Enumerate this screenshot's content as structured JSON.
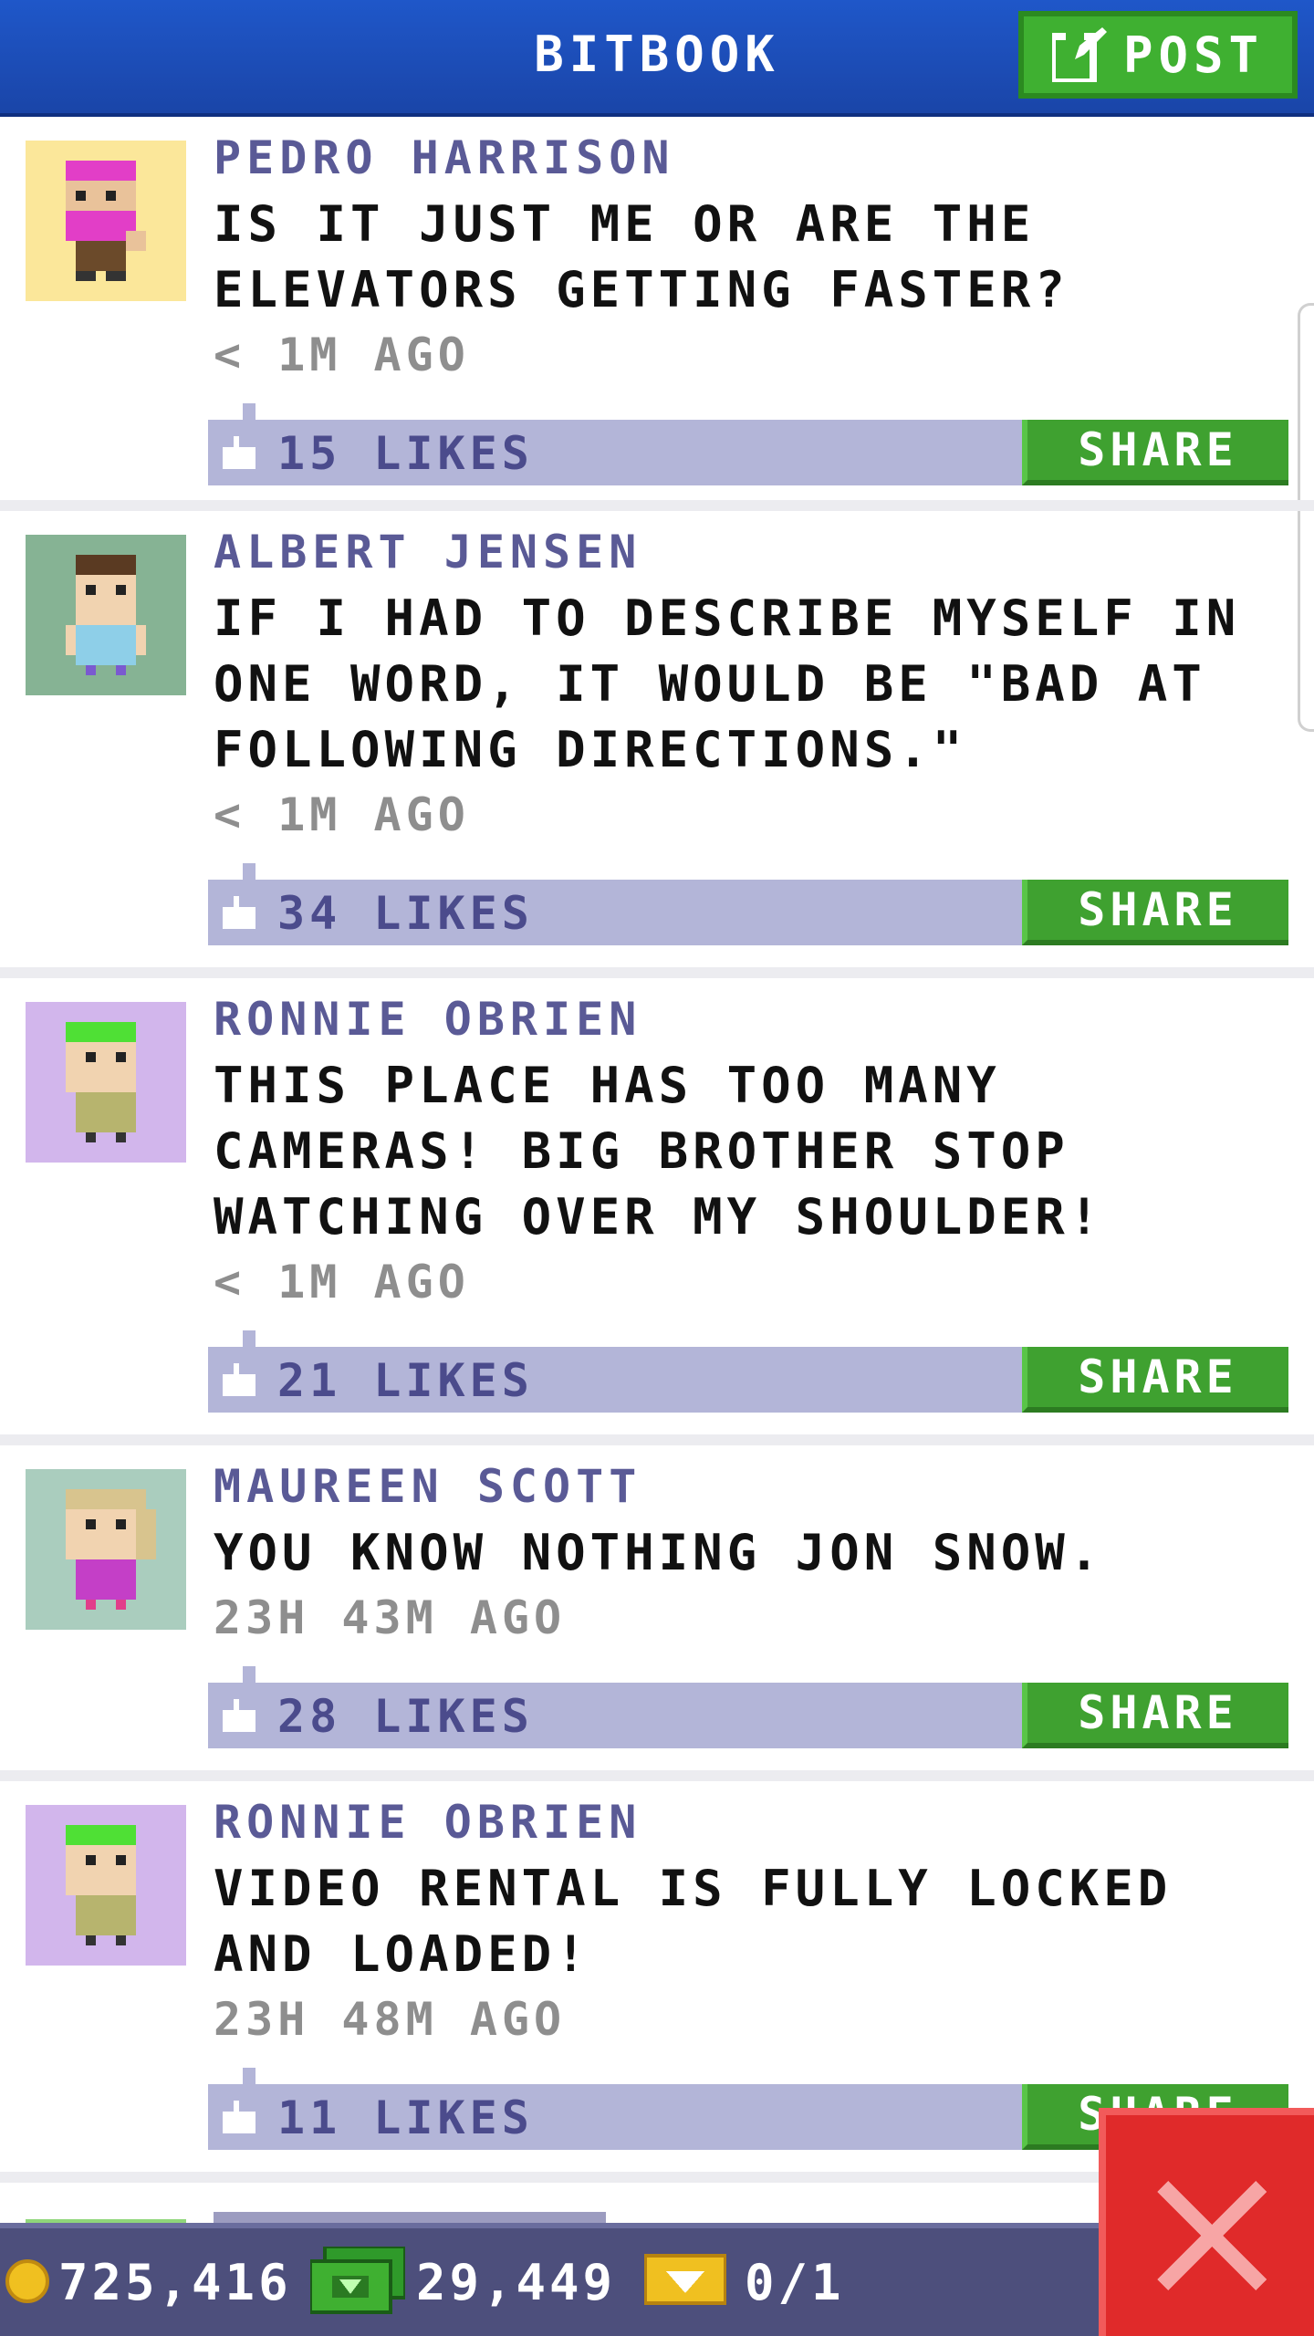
{
  "header": {
    "title": "BITBOOK",
    "post_label": "POST"
  },
  "posts": [
    {
      "author": "PEDRO HARRISON",
      "text": "IS IT JUST ME OR ARE THE ELEVATORS GETTING FASTER?",
      "time": "< 1M AGO",
      "likes": "15 LIKES",
      "share": "SHARE",
      "avatar_bg": "#fbe79a"
    },
    {
      "author": "ALBERT JENSEN",
      "text": "IF I HAD TO DESCRIBE MYSELF IN ONE WORD, IT WOULD BE \"BAD AT FOLLOWING DIRECTIONS.\"",
      "time": "< 1M AGO",
      "likes": "34 LIKES",
      "share": "SHARE",
      "avatar_bg": "#86b394"
    },
    {
      "author": "RONNIE OBRIEN",
      "text": "THIS PLACE HAS TOO MANY CAMERAS! BIG BROTHER STOP WATCHING OVER MY SHOULDER!",
      "time": "< 1M AGO",
      "likes": "21 LIKES",
      "share": "SHARE",
      "avatar_bg": "#d2b6ec"
    },
    {
      "author": "MAUREEN SCOTT",
      "text": "YOU KNOW NOTHING JON SNOW.",
      "time": "23H 43M AGO",
      "likes": "28 LIKES",
      "share": "SHARE",
      "avatar_bg": "#aacdbe"
    },
    {
      "author": "RONNIE OBRIEN",
      "text": "VIDEO RENTAL IS FULLY LOCKED AND LOADED!",
      "time": "23H 48M AGO",
      "likes": "11 LIKES",
      "share": "SHARE",
      "avatar_bg": "#d2b6ec"
    }
  ],
  "bottom_bar": {
    "coins": "725,416",
    "bux": "29,449",
    "vip": "0/1"
  },
  "colors": {
    "header": "#1f57c9",
    "accent_green": "#3fb031",
    "like_bar": "#b3b5d8",
    "bottom_bar": "#4d4f7c",
    "close_red": "#e02a2a"
  }
}
